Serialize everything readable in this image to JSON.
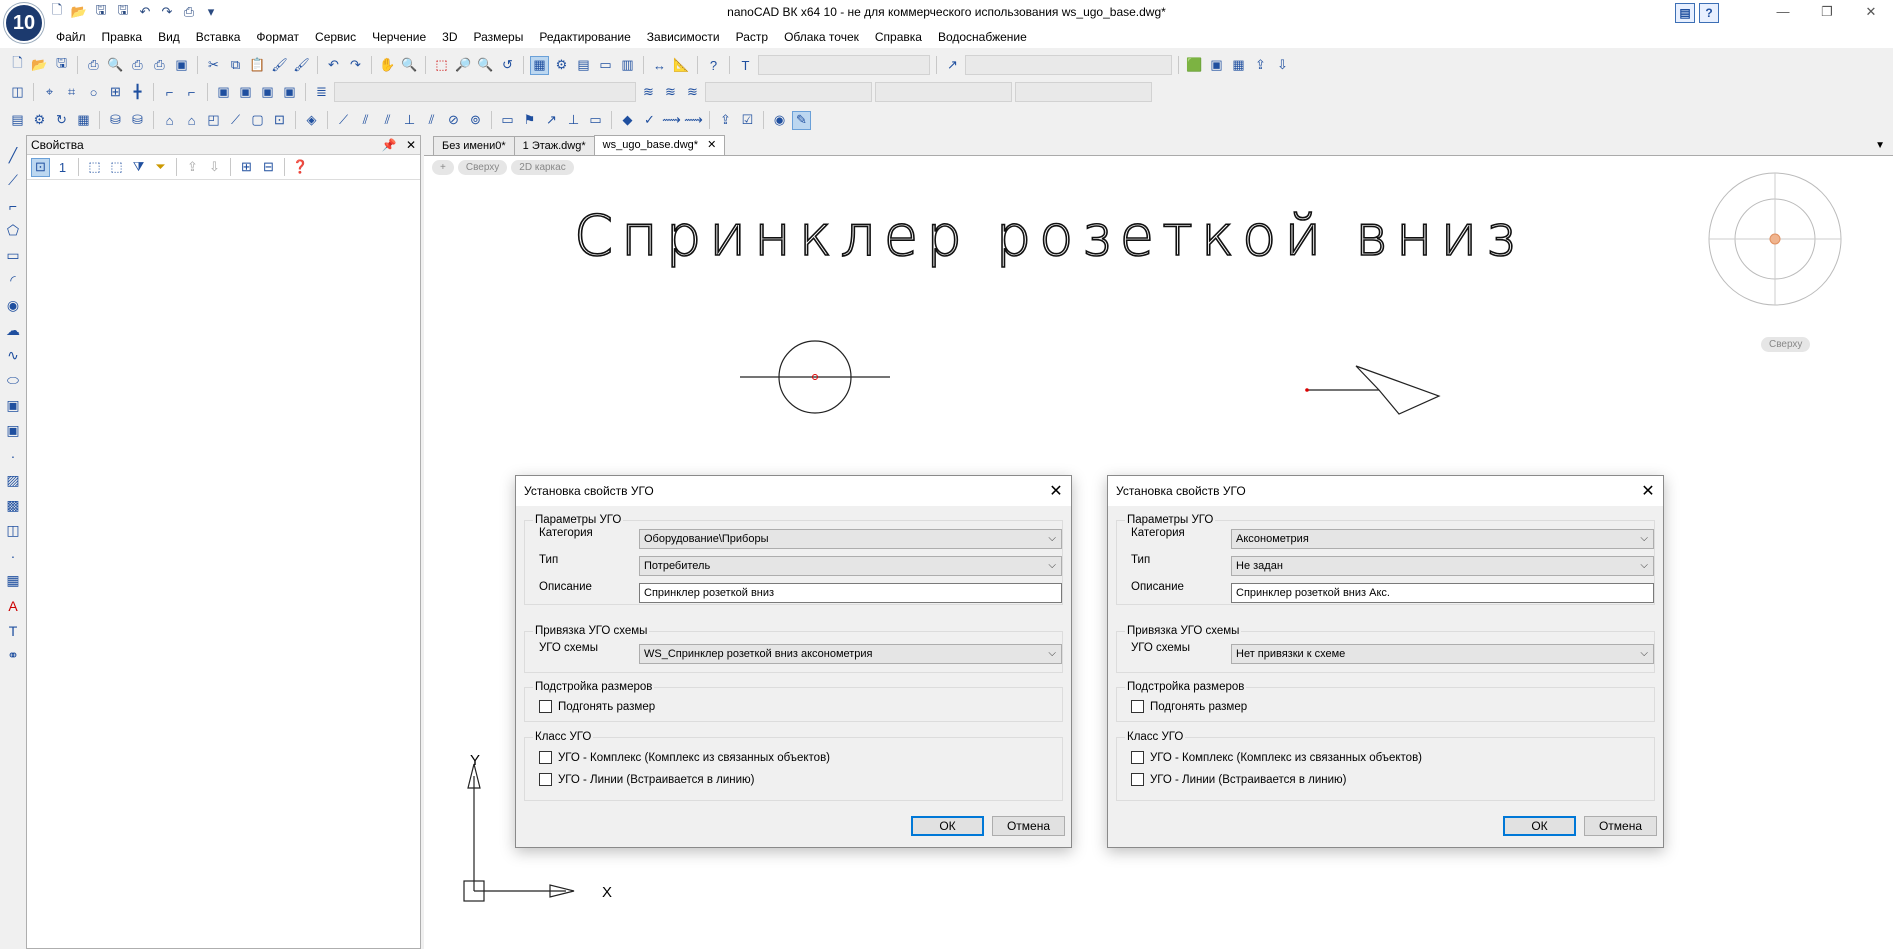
{
  "app": {
    "logo_text": "10",
    "title": "nanoCAD ВК x64 10 - не для коммерческого использования ws_ugo_base.dwg*"
  },
  "menu": [
    "Файл",
    "Правка",
    "Вид",
    "Вставка",
    "Формат",
    "Сервис",
    "Черчение",
    "3D",
    "Размеры",
    "Редактирование",
    "Зависимости",
    "Растр",
    "Облака точек",
    "Справка",
    "Водоснабжение"
  ],
  "properties_panel": {
    "title": "Свойства",
    "pin_icon": "pin-icon",
    "close_label": "✕"
  },
  "doc_tabs": [
    {
      "label": "Без имени0*",
      "active": false
    },
    {
      "label": "1 Этаж.dwg*",
      "active": false
    },
    {
      "label": "ws_ugo_base.dwg*",
      "active": true
    }
  ],
  "view_controls": {
    "add": "+",
    "view": "Сверху",
    "style": "2D каркас"
  },
  "viewcube": {
    "label": "Сверху"
  },
  "drawing": {
    "text": "Спринклер розеткой вниз",
    "axis_x": "X",
    "axis_y": "Y"
  },
  "dialog_left": {
    "title": "Установка свойств УГО",
    "group_params": "Параметры УГО",
    "category_label": "Категория",
    "category_value": "Оборудование\\Приборы",
    "type_label": "Тип",
    "type_value": "Потребитель",
    "desc_label": "Описание",
    "desc_value": "Спринклер розеткой вниз",
    "group_binding": "Привязка УГО схемы",
    "scheme_label": "УГО схемы",
    "scheme_value": "WS_Спринклер розеткой вниз аксонометрия",
    "group_size": "Подстройка размеров",
    "fit_label": "Подгонять размер",
    "group_class": "Класс УГО",
    "class_complex": "УГО - Комплекс (Комплекс из связанных объектов)",
    "class_lines": "УГО - Линии (Встраивается в линию)",
    "ok": "ОК",
    "cancel": "Отмена"
  },
  "dialog_right": {
    "title": "Установка свойств УГО",
    "group_params": "Параметры УГО",
    "category_label": "Категория",
    "category_value": "Аксонометрия",
    "type_label": "Тип",
    "type_value": "Не задан",
    "desc_label": "Описание",
    "desc_value": "Спринклер розеткой вниз Акс.",
    "group_binding": "Привязка УГО схемы",
    "scheme_label": "УГО схемы",
    "scheme_value": "Нет привязки к схеме",
    "group_size": "Подстройка размеров",
    "fit_label": "Подгонять размер",
    "group_class": "Класс УГО",
    "class_complex": "УГО - Комплекс (Комплекс из связанных объектов)",
    "class_lines": "УГО - Линии (Встраивается в линию)",
    "ok": "ОК",
    "cancel": "Отмена"
  }
}
